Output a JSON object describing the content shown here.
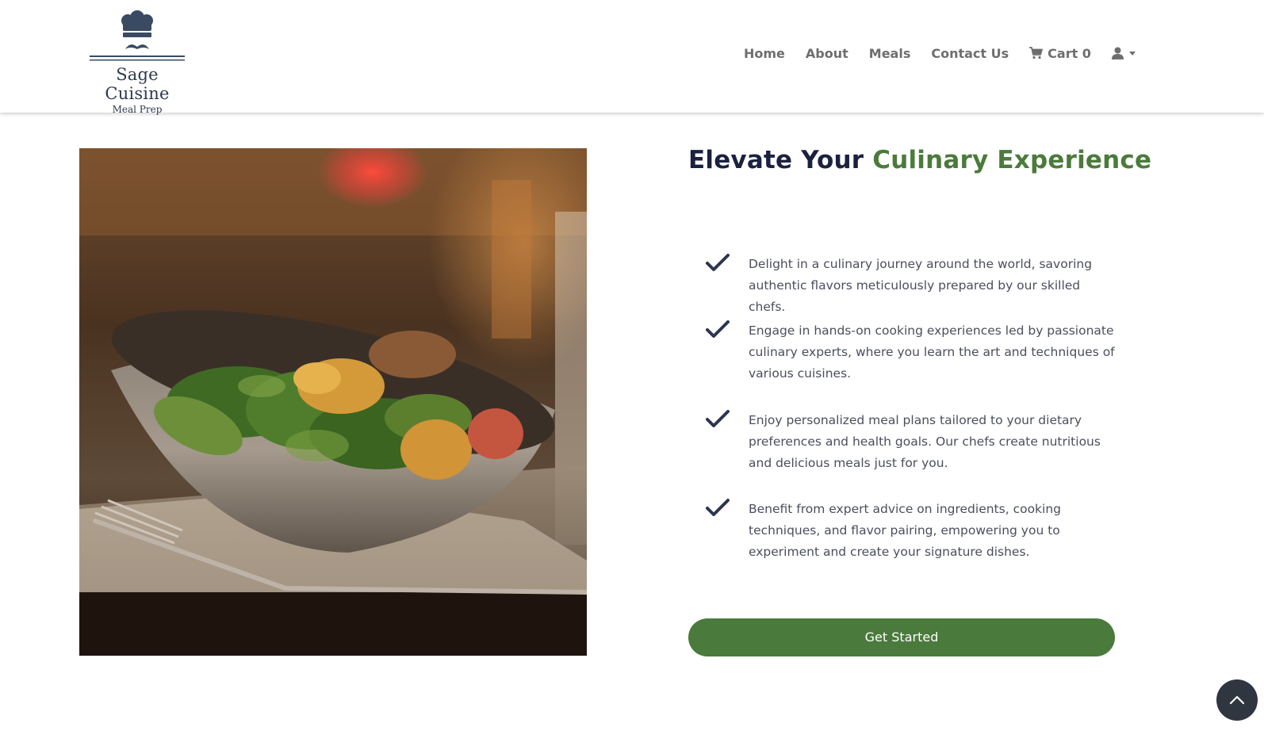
{
  "brand": {
    "name": "Sage Cuisine",
    "tagline": "Meal Prep",
    "logo_icon": "chef-hat-mustache-icon"
  },
  "nav": {
    "items": [
      {
        "label": "Home"
      },
      {
        "label": "About"
      },
      {
        "label": "Meals"
      },
      {
        "label": "Contact Us"
      }
    ],
    "cart_label": "Cart 0",
    "cart_icon": "shopping-cart-icon",
    "user_icon": "user-icon"
  },
  "hero": {
    "image_subject": "salad-bowl-photo",
    "title_part1": "Elevate Your",
    "title_part2": "Culinary Experience",
    "features": [
      {
        "text": "Delight in a culinary journey around the world, savoring authentic flavors meticulously prepared by our skilled chefs."
      },
      {
        "text": "Engage in hands-on cooking experiences led by passionate culinary experts, where you learn the art and techniques of various cuisines."
      },
      {
        "text": "Enjoy personalized meal plans tailored to your dietary preferences and health goals. Our chefs create nutritious and delicious meals just for you."
      },
      {
        "text": "Benefit from expert advice on ingredients, cooking techniques, and flavor pairing, empowering you to experiment and create your signature dishes."
      }
    ],
    "cta_label": "Get Started"
  },
  "colors": {
    "accent_green": "#4b7b3b",
    "navy": "#1c2140",
    "nav_text": "#6e6e6e",
    "scroll_button": "#2f3640"
  }
}
